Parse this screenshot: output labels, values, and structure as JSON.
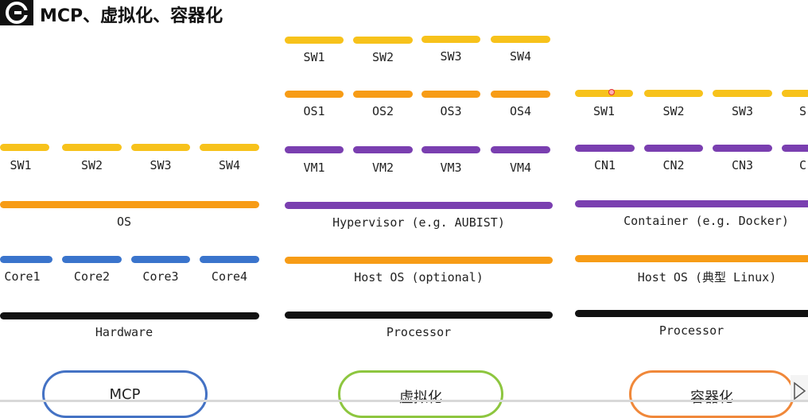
{
  "header": {
    "title": "MCP、虚拟化、容器化",
    "logo_icon": "c-logo-icon"
  },
  "colors": {
    "yellow": "#f7c21b",
    "orange": "#f79c16",
    "purple": "#7a3fb0",
    "blue": "#3a74cc",
    "black": "#111111",
    "pill_mcp": "#4472c4",
    "pill_virt": "#8dc63f",
    "pill_container": "#f0883a"
  },
  "mcp": {
    "sw": [
      "SW1",
      "SW2",
      "SW3",
      "SW4"
    ],
    "os": "OS",
    "cores": [
      "Core1",
      "Core2",
      "Core3",
      "Core4"
    ],
    "hardware": "Hardware",
    "pill": "MCP"
  },
  "virtualization": {
    "sw": [
      "SW1",
      "SW2",
      "SW3",
      "SW4"
    ],
    "os": [
      "OS1",
      "OS2",
      "OS3",
      "OS4"
    ],
    "vm": [
      "VM1",
      "VM2",
      "VM3",
      "VM4"
    ],
    "hypervisor": "Hypervisor (e.g. AUBIST)",
    "host_os": "Host OS (optional)",
    "processor": "Processor",
    "pill": "虚拟化"
  },
  "containerization": {
    "sw": [
      "SW1",
      "SW2",
      "SW3",
      "S"
    ],
    "cn": [
      "CN1",
      "CN2",
      "CN3",
      "C"
    ],
    "container": "Container (e.g. Docker)",
    "host_os": "Host OS (典型 Linux)",
    "processor": "Processor",
    "pill": "容器化"
  }
}
